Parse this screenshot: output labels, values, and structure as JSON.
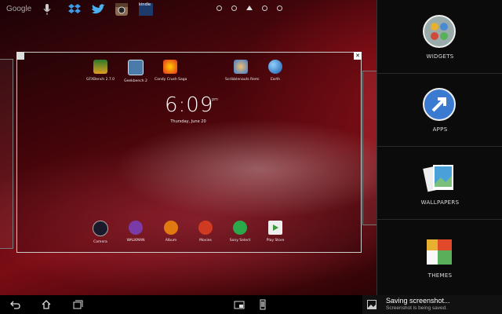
{
  "topbar": {
    "search_label": "Google",
    "kindle_label": "kindle"
  },
  "home": {
    "apps": [
      {
        "label": "GFXBench 2.7.0"
      },
      {
        "label": "Geekbench 2"
      },
      {
        "label": "Candy Crush Saga"
      },
      {
        "label": "Scribblenauts Remi"
      },
      {
        "label": "Earth"
      }
    ],
    "clock": {
      "time": "6:09",
      "ampm": "pm",
      "date": "Thursday, June 20"
    },
    "dock": [
      {
        "label": "Camera"
      },
      {
        "label": "WALKMAN"
      },
      {
        "label": "Album"
      },
      {
        "label": "Movies"
      },
      {
        "label": "Sony Select"
      },
      {
        "label": "Play Store"
      }
    ]
  },
  "side_panel": {
    "items": [
      {
        "label": "WIDGETS",
        "icon": "widgets-icon"
      },
      {
        "label": "APPS",
        "icon": "apps-icon"
      },
      {
        "label": "WALLPAPERS",
        "icon": "wallpapers-icon"
      },
      {
        "label": "THEMES",
        "icon": "themes-icon"
      }
    ]
  },
  "toast": {
    "title": "Saving screenshot...",
    "subtitle": "Screenshot is being saved."
  },
  "colors": {
    "wallpaper_accent": "#7a0c14",
    "panel_bg": "#0b0b0b"
  }
}
